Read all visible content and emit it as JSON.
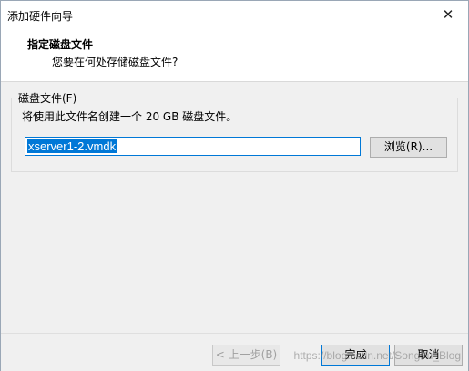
{
  "window": {
    "title": "添加硬件向导",
    "close_glyph": "✕"
  },
  "header": {
    "title": "指定磁盘文件",
    "subtitle": "您要在何处存储磁盘文件?"
  },
  "disk_file_group": {
    "legend": "磁盘文件(F)",
    "description": "将使用此文件名创建一个 20 GB 磁盘文件。",
    "file_name_value": "xserver1-2.vmdk",
    "browse_label": "浏览(R)..."
  },
  "footer": {
    "back_label": "< 上一步(B)",
    "finish_label": "完成",
    "cancel_label": "取消",
    "watermark": "https://blog.csdn.net/SongYu_Blog"
  }
}
